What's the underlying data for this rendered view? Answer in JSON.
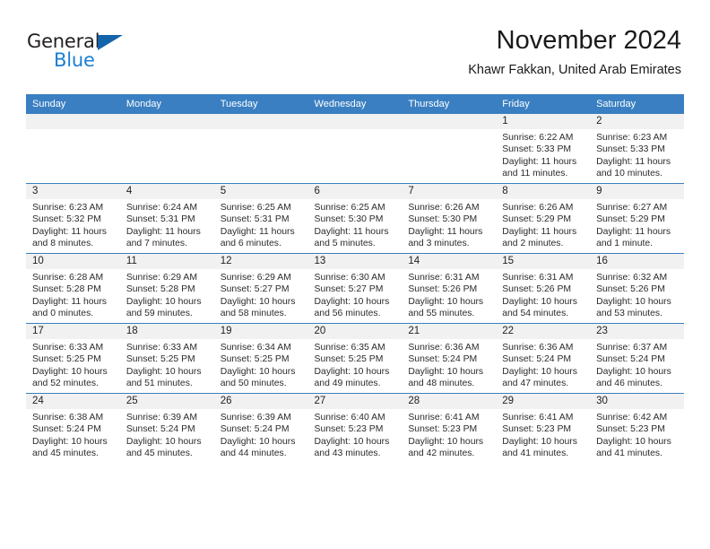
{
  "brand": {
    "name_part1": "General",
    "name_part2": "Blue",
    "flag_icon": "blue-triangle-flag-icon",
    "colors": {
      "dark": "#231f20",
      "blue": "#1b7fd4",
      "flag": "#1464ab"
    }
  },
  "header": {
    "month_title": "November 2024",
    "location": "Khawr Fakkan, United Arab Emirates"
  },
  "theme": {
    "header_row_bg": "#3a7fc1",
    "daynum_band_bg": "#f1f1f1",
    "grid_line": "#3a7fc1",
    "page_bg": "#ffffff"
  },
  "columns": [
    {
      "label": "Sunday"
    },
    {
      "label": "Monday"
    },
    {
      "label": "Tuesday"
    },
    {
      "label": "Wednesday"
    },
    {
      "label": "Thursday"
    },
    {
      "label": "Friday"
    },
    {
      "label": "Saturday"
    }
  ],
  "weeks": [
    [
      {
        "empty": true
      },
      {
        "empty": true
      },
      {
        "empty": true
      },
      {
        "empty": true
      },
      {
        "empty": true
      },
      {
        "day": "1",
        "sunrise": "Sunrise: 6:22 AM",
        "sunset": "Sunset: 5:33 PM",
        "daylight": "Daylight: 11 hours and 11 minutes."
      },
      {
        "day": "2",
        "sunrise": "Sunrise: 6:23 AM",
        "sunset": "Sunset: 5:33 PM",
        "daylight": "Daylight: 11 hours and 10 minutes."
      }
    ],
    [
      {
        "day": "3",
        "sunrise": "Sunrise: 6:23 AM",
        "sunset": "Sunset: 5:32 PM",
        "daylight": "Daylight: 11 hours and 8 minutes."
      },
      {
        "day": "4",
        "sunrise": "Sunrise: 6:24 AM",
        "sunset": "Sunset: 5:31 PM",
        "daylight": "Daylight: 11 hours and 7 minutes."
      },
      {
        "day": "5",
        "sunrise": "Sunrise: 6:25 AM",
        "sunset": "Sunset: 5:31 PM",
        "daylight": "Daylight: 11 hours and 6 minutes."
      },
      {
        "day": "6",
        "sunrise": "Sunrise: 6:25 AM",
        "sunset": "Sunset: 5:30 PM",
        "daylight": "Daylight: 11 hours and 5 minutes."
      },
      {
        "day": "7",
        "sunrise": "Sunrise: 6:26 AM",
        "sunset": "Sunset: 5:30 PM",
        "daylight": "Daylight: 11 hours and 3 minutes."
      },
      {
        "day": "8",
        "sunrise": "Sunrise: 6:26 AM",
        "sunset": "Sunset: 5:29 PM",
        "daylight": "Daylight: 11 hours and 2 minutes."
      },
      {
        "day": "9",
        "sunrise": "Sunrise: 6:27 AM",
        "sunset": "Sunset: 5:29 PM",
        "daylight": "Daylight: 11 hours and 1 minute."
      }
    ],
    [
      {
        "day": "10",
        "sunrise": "Sunrise: 6:28 AM",
        "sunset": "Sunset: 5:28 PM",
        "daylight": "Daylight: 11 hours and 0 minutes."
      },
      {
        "day": "11",
        "sunrise": "Sunrise: 6:29 AM",
        "sunset": "Sunset: 5:28 PM",
        "daylight": "Daylight: 10 hours and 59 minutes."
      },
      {
        "day": "12",
        "sunrise": "Sunrise: 6:29 AM",
        "sunset": "Sunset: 5:27 PM",
        "daylight": "Daylight: 10 hours and 58 minutes."
      },
      {
        "day": "13",
        "sunrise": "Sunrise: 6:30 AM",
        "sunset": "Sunset: 5:27 PM",
        "daylight": "Daylight: 10 hours and 56 minutes."
      },
      {
        "day": "14",
        "sunrise": "Sunrise: 6:31 AM",
        "sunset": "Sunset: 5:26 PM",
        "daylight": "Daylight: 10 hours and 55 minutes."
      },
      {
        "day": "15",
        "sunrise": "Sunrise: 6:31 AM",
        "sunset": "Sunset: 5:26 PM",
        "daylight": "Daylight: 10 hours and 54 minutes."
      },
      {
        "day": "16",
        "sunrise": "Sunrise: 6:32 AM",
        "sunset": "Sunset: 5:26 PM",
        "daylight": "Daylight: 10 hours and 53 minutes."
      }
    ],
    [
      {
        "day": "17",
        "sunrise": "Sunrise: 6:33 AM",
        "sunset": "Sunset: 5:25 PM",
        "daylight": "Daylight: 10 hours and 52 minutes."
      },
      {
        "day": "18",
        "sunrise": "Sunrise: 6:33 AM",
        "sunset": "Sunset: 5:25 PM",
        "daylight": "Daylight: 10 hours and 51 minutes."
      },
      {
        "day": "19",
        "sunrise": "Sunrise: 6:34 AM",
        "sunset": "Sunset: 5:25 PM",
        "daylight": "Daylight: 10 hours and 50 minutes."
      },
      {
        "day": "20",
        "sunrise": "Sunrise: 6:35 AM",
        "sunset": "Sunset: 5:25 PM",
        "daylight": "Daylight: 10 hours and 49 minutes."
      },
      {
        "day": "21",
        "sunrise": "Sunrise: 6:36 AM",
        "sunset": "Sunset: 5:24 PM",
        "daylight": "Daylight: 10 hours and 48 minutes."
      },
      {
        "day": "22",
        "sunrise": "Sunrise: 6:36 AM",
        "sunset": "Sunset: 5:24 PM",
        "daylight": "Daylight: 10 hours and 47 minutes."
      },
      {
        "day": "23",
        "sunrise": "Sunrise: 6:37 AM",
        "sunset": "Sunset: 5:24 PM",
        "daylight": "Daylight: 10 hours and 46 minutes."
      }
    ],
    [
      {
        "day": "24",
        "sunrise": "Sunrise: 6:38 AM",
        "sunset": "Sunset: 5:24 PM",
        "daylight": "Daylight: 10 hours and 45 minutes."
      },
      {
        "day": "25",
        "sunrise": "Sunrise: 6:39 AM",
        "sunset": "Sunset: 5:24 PM",
        "daylight": "Daylight: 10 hours and 45 minutes."
      },
      {
        "day": "26",
        "sunrise": "Sunrise: 6:39 AM",
        "sunset": "Sunset: 5:24 PM",
        "daylight": "Daylight: 10 hours and 44 minutes."
      },
      {
        "day": "27",
        "sunrise": "Sunrise: 6:40 AM",
        "sunset": "Sunset: 5:23 PM",
        "daylight": "Daylight: 10 hours and 43 minutes."
      },
      {
        "day": "28",
        "sunrise": "Sunrise: 6:41 AM",
        "sunset": "Sunset: 5:23 PM",
        "daylight": "Daylight: 10 hours and 42 minutes."
      },
      {
        "day": "29",
        "sunrise": "Sunrise: 6:41 AM",
        "sunset": "Sunset: 5:23 PM",
        "daylight": "Daylight: 10 hours and 41 minutes."
      },
      {
        "day": "30",
        "sunrise": "Sunrise: 6:42 AM",
        "sunset": "Sunset: 5:23 PM",
        "daylight": "Daylight: 10 hours and 41 minutes."
      }
    ]
  ]
}
